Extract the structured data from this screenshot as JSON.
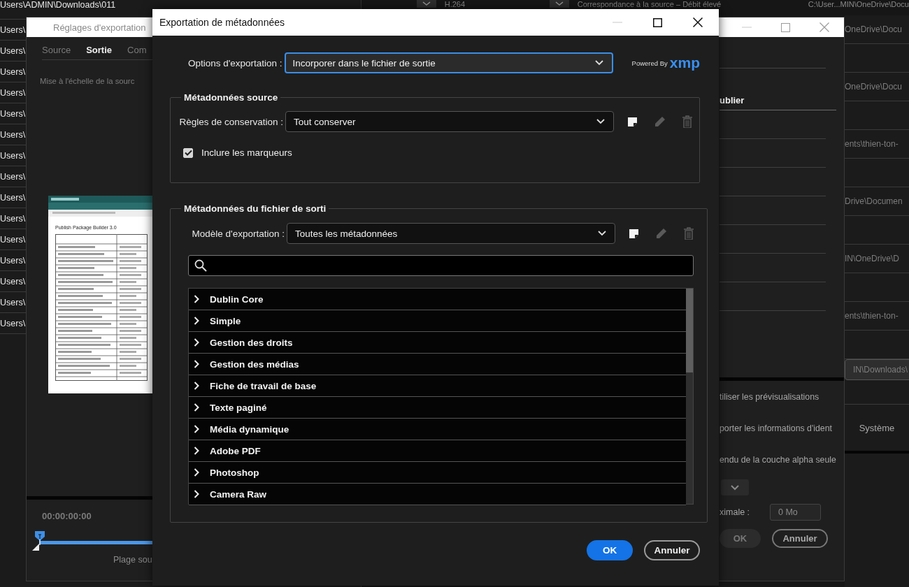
{
  "background_list": {
    "header": "Users\\ADMIN\\Downloads\\011",
    "rows": [
      "Users\\",
      "Users\\",
      "Users\\",
      "Users\\",
      "Users\\",
      "Users\\",
      "Users\\",
      "Users\\",
      "Users\\",
      "Users\\",
      "Users\\",
      "Users\\",
      "Users\\",
      "Users\\",
      "Users\\"
    ]
  },
  "background_toolbar": {
    "dropdowns": [
      "H.264",
      "Correspondance à la source – Débit élevé"
    ],
    "path": "C:\\User...MIN\\OneDrive\\Docu"
  },
  "background_paths": [
    {
      "path": "OneDrive\\Docu",
      "selected": false
    },
    {
      "path": "OneDrive\\Docu",
      "selected": false
    },
    {
      "path": "ents\\thien-ton-",
      "selected": false
    },
    {
      "path": "Drive\\Documen",
      "selected": false
    },
    {
      "path": "IN\\OneDrive\\D",
      "selected": false
    },
    {
      "path": "ents\\thien-ton-",
      "selected": false
    },
    {
      "path": "IN\\Downloads\\",
      "selected": true
    }
  ],
  "background_system_label": "Système",
  "export_settings": {
    "title": "Réglages d'exportation",
    "tabs": [
      {
        "label": "Source",
        "selected": false
      },
      {
        "label": "Sortie",
        "selected": true
      },
      {
        "label": "Com",
        "selected": false
      }
    ],
    "scaling_label": "Mise à l'échelle de la sourc",
    "preview_title": "Publish Package Builder 3.0",
    "timecode": "00:00:00:00",
    "range_label": "Plage sou",
    "right_tab": "ublier",
    "options": [
      "tiliser les prévisualisations",
      "porter les informations d'ident",
      "endu de la couche alpha seule"
    ],
    "max_label": "ximale :",
    "max_value": "0 Mo",
    "buttons": [
      "OK",
      "Annuler"
    ]
  },
  "metadata_dialog": {
    "title": "Exportation de métadonnées",
    "export_options": {
      "label": "Options d'exportation :",
      "value": "Incorporer dans le fichier de sortie",
      "focused": true
    },
    "powered_by": "Powered By",
    "logo": "xmp",
    "source_section": {
      "title": "Métadonnées source",
      "rules": {
        "label": "Règles de conservation :",
        "value": "Tout conserver"
      },
      "actions": [
        {
          "disabled": false
        },
        {
          "disabled": true
        },
        {
          "disabled": true
        }
      ],
      "include_markers": {
        "label": "Inclure les marqueurs",
        "checked": true
      }
    },
    "output_section": {
      "title": "Métadonnées du fichier de sorti",
      "template": {
        "label": "Modèle d'exportation :",
        "value": "Toutes les métadonnées"
      },
      "actions": [
        {
          "disabled": false
        },
        {
          "disabled": true
        },
        {
          "disabled": true
        }
      ],
      "tree": [
        {
          "label": "Dublin Core",
          "expanded": false
        },
        {
          "label": "Simple",
          "expanded": false
        },
        {
          "label": "Gestion des droits",
          "expanded": false
        },
        {
          "label": "Gestion des médias",
          "expanded": false
        },
        {
          "label": "Fiche de travail de base",
          "expanded": false
        },
        {
          "label": "Texte paginé",
          "expanded": false
        },
        {
          "label": "Média dynamique",
          "expanded": false
        },
        {
          "label": "Adobe PDF",
          "expanded": false
        },
        {
          "label": "Photoshop",
          "expanded": false
        },
        {
          "label": "Camera Raw",
          "expanded": false
        }
      ]
    },
    "buttons": [
      {
        "label": "OK",
        "primary": true
      },
      {
        "label": "Annuler",
        "primary": false
      }
    ]
  }
}
